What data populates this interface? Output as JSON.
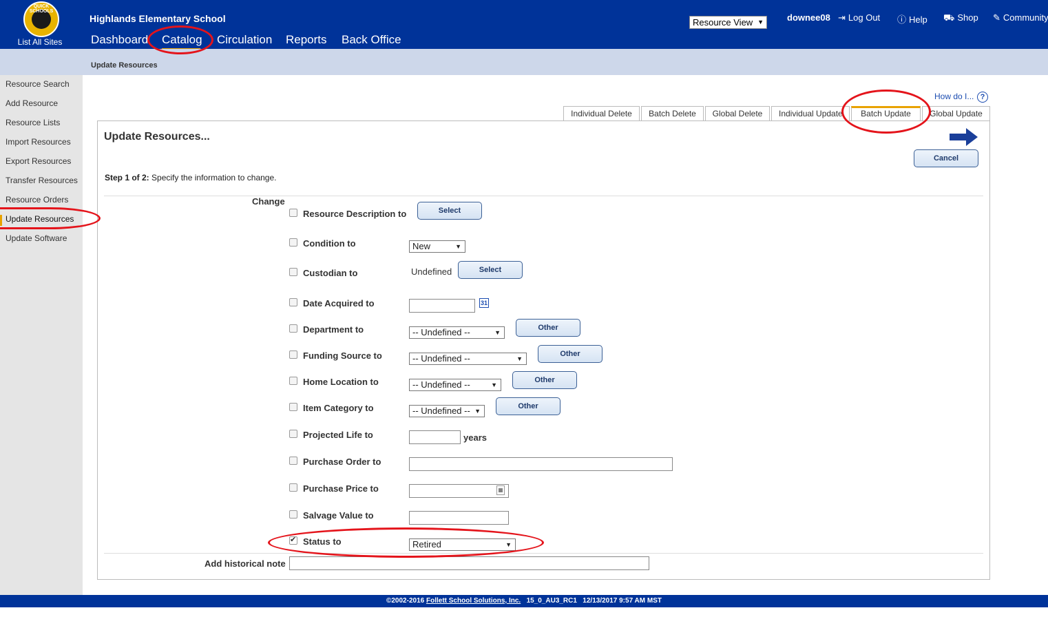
{
  "header": {
    "logo_text": "QUICK SCHOOLS",
    "list_all_sites": "List All Sites",
    "school_name": "Highlands Elementary School",
    "nav": [
      "Dashboard",
      "Catalog",
      "Circulation",
      "Reports",
      "Back Office"
    ],
    "view_select": "Resource View",
    "user": "downee08",
    "links": {
      "logout": "Log Out",
      "help": "Help",
      "shop": "Shop",
      "community": "Community"
    }
  },
  "subheader": {
    "title": "Update Resources"
  },
  "sidebar": {
    "items": [
      "Resource Search",
      "Add Resource",
      "Resource Lists",
      "Import Resources",
      "Export Resources",
      "Transfer Resources",
      "Resource Orders",
      "Update Resources",
      "Update Software"
    ],
    "active": "Update Resources"
  },
  "howdo": "How do I...",
  "tabs": [
    "Individual Delete",
    "Batch Delete",
    "Global Delete",
    "Individual Update",
    "Batch Update",
    "Global Update"
  ],
  "active_tab": "Batch Update",
  "panel": {
    "title": "Update Resources...",
    "cancel": "Cancel",
    "step_bold": "Step 1 of 2:",
    "step_text": "Specify the information to change.",
    "change_label": "Change"
  },
  "fields": {
    "resource_description": {
      "label": "Resource Description to",
      "button": "Select",
      "checked": false
    },
    "condition": {
      "label": "Condition to",
      "value": "New",
      "checked": false
    },
    "custodian": {
      "label": "Custodian to",
      "value": "Undefined",
      "button": "Select",
      "checked": false
    },
    "date_acquired": {
      "label": "Date Acquired to",
      "value": "",
      "calendar": "31",
      "checked": false
    },
    "department": {
      "label": "Department to",
      "value": "-- Undefined --",
      "button": "Other",
      "checked": false
    },
    "funding_source": {
      "label": "Funding Source to",
      "value": "-- Undefined --",
      "button": "Other",
      "checked": false
    },
    "home_location": {
      "label": "Home Location to",
      "value": "-- Undefined --",
      "button": "Other",
      "checked": false
    },
    "item_category": {
      "label": "Item Category to",
      "value": "-- Undefined --",
      "button": "Other",
      "checked": false
    },
    "projected_life": {
      "label": "Projected Life to",
      "value": "",
      "unit": "years",
      "checked": false
    },
    "purchase_order": {
      "label": "Purchase Order to",
      "value": "",
      "checked": false
    },
    "purchase_price": {
      "label": "Purchase Price to",
      "value": "",
      "checked": false
    },
    "salvage_value": {
      "label": "Salvage Value to",
      "value": "",
      "checked": false
    },
    "status": {
      "label": "Status to",
      "value": "Retired",
      "checked": true
    },
    "historical_note": {
      "label": "Add historical note",
      "value": ""
    }
  },
  "footer": {
    "copyright": "©2002-2016",
    "company": "Follett School Solutions, Inc.",
    "version": "15_0_AU3_RC1",
    "timestamp": "12/13/2017 9:57 AM MST"
  },
  "colors": {
    "header_bg": "#003399",
    "subbar_bg": "#cdd7ea",
    "accent_orange": "#e8a200",
    "annotation_red": "#e4141b"
  }
}
